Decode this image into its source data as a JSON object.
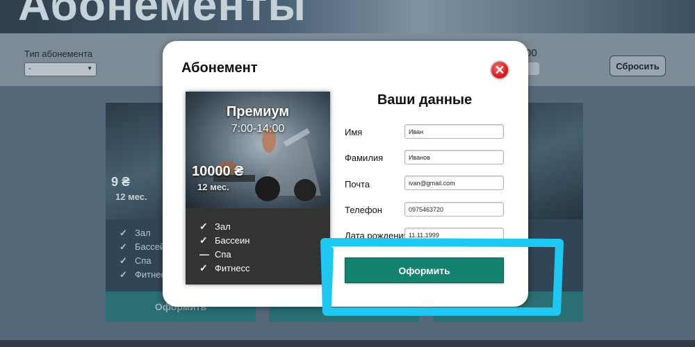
{
  "page": {
    "hero_title": "Абонементы"
  },
  "filters": {
    "type_label": "Тип абонемента",
    "type_value": "-",
    "right_label": "00",
    "reset_label": "Сбросить"
  },
  "background_cards": [
    {
      "price": "9 ₴",
      "period": "12 мес.",
      "features": [
        {
          "mark": "✓",
          "label": "Зал"
        },
        {
          "mark": "✓",
          "label": "Бассейн"
        },
        {
          "mark": "✓",
          "label": "Спа"
        },
        {
          "mark": "✓",
          "label": "Фитнесс"
        }
      ],
      "button": "Оформить"
    },
    {
      "button": ""
    },
    {
      "button": ""
    }
  ],
  "modal": {
    "title": "Абонемент",
    "close_icon": "close-icon",
    "plan": {
      "name": "Премиум",
      "hours": "7:00-14:00",
      "price": "10000 ₴",
      "period": "12 мес.",
      "features": [
        {
          "mark": "✓",
          "label": "Зал"
        },
        {
          "mark": "✓",
          "label": "Бассеин"
        },
        {
          "mark": "—",
          "label": "Спа"
        },
        {
          "mark": "✓",
          "label": "Фитнесс"
        }
      ]
    },
    "form": {
      "title": "Ваши данные",
      "fields": [
        {
          "label": "Имя",
          "value": "Иван"
        },
        {
          "label": "Фамилия",
          "value": "Иванов"
        },
        {
          "label": "Почта",
          "value": "ivan@gmail.com"
        },
        {
          "label": "Телефон",
          "value": "0975463720"
        },
        {
          "label": "Дата рождения",
          "value": "11.11.1999"
        }
      ],
      "submit": "Оформить"
    }
  },
  "colors": {
    "accent": "#13826f",
    "highlight": "#1ec8f0",
    "close": "#d81e1e"
  }
}
